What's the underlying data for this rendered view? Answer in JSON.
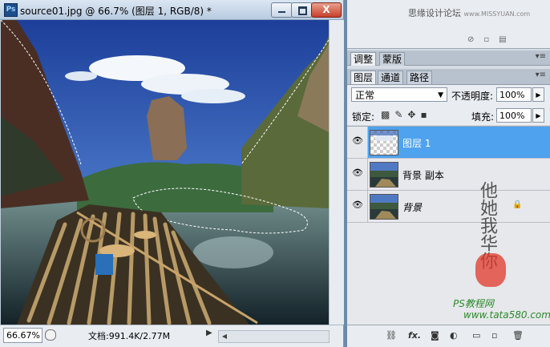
{
  "document": {
    "title": "source01.jpg @ 66.7% (图层 1, RGB/8) *",
    "app_icon": "Ps",
    "zoom": "66.67%",
    "doc_size": "文档:991.4K/2.77M",
    "close_glyph": "X"
  },
  "watermark": {
    "forum": "思缘设计论坛",
    "site": "www.MISSYUAN.com",
    "tutorial": "PS教程网",
    "url": "www.tata580.com",
    "signature": "他她我华你"
  },
  "adjust_panel": {
    "tabs": [
      "调整",
      "蒙版"
    ]
  },
  "layers_panel": {
    "tabs": [
      "图层",
      "通道",
      "路径"
    ],
    "blend_mode": "正常",
    "opacity_label": "不透明度:",
    "opacity": "100%",
    "lock_label": "锁定:",
    "fill_label": "填充:",
    "fill": "100%",
    "layers": [
      {
        "name": "图层 1",
        "visible": true,
        "selected": true,
        "thumb": "transparent"
      },
      {
        "name": "背景 副本",
        "visible": true,
        "selected": false,
        "thumb": "landscape"
      },
      {
        "name": "背景",
        "visible": true,
        "selected": false,
        "thumb": "landscape",
        "locked": true
      }
    ]
  },
  "colors": {
    "selection": "#4ea2ee",
    "chrome": "#d6dce4"
  }
}
